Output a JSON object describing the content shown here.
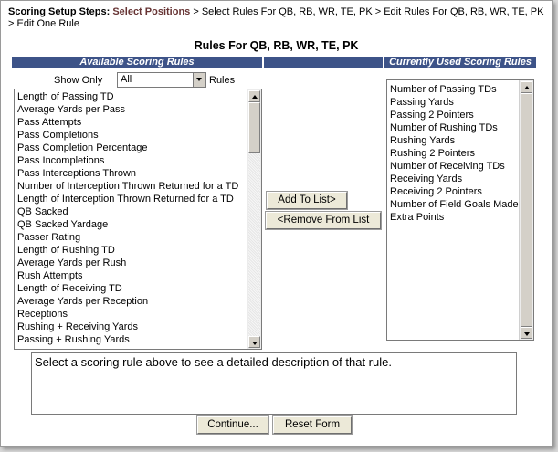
{
  "breadcrumb": {
    "label": "Scoring Setup Steps:",
    "current": "Select Positions",
    "rest": " > Select Rules For QB, RB, WR, TE, PK > Edit Rules For QB, RB, WR, TE, PK > Edit One Rule"
  },
  "page_title": "Rules For QB, RB, WR, TE, PK",
  "available": {
    "header": "Available Scoring Rules",
    "show_only_label": "Show Only",
    "filter_value": "All",
    "rules_suffix": "Rules",
    "items": [
      "Length of Passing TD",
      "Average Yards per Pass",
      "Pass Attempts",
      "Pass Completions",
      "Pass Completion Percentage",
      "Pass Incompletions",
      "Pass Interceptions Thrown",
      "Number of Interception Thrown Returned for a TD",
      "Length of Interception Thrown Returned for a TD",
      "QB Sacked",
      "QB Sacked Yardage",
      "Passer Rating",
      "Length of Rushing TD",
      "Average Yards per Rush",
      "Rush Attempts",
      "Length of Receiving TD",
      "Average Yards per Reception",
      "Receptions",
      "Rushing + Receiving Yards",
      "Passing + Rushing Yards"
    ]
  },
  "used": {
    "header": "Currently Used Scoring Rules",
    "items": [
      "Number of Passing TDs",
      "Passing Yards",
      "Passing 2 Pointers",
      "Number of Rushing TDs",
      "Rushing Yards",
      "Rushing 2 Pointers",
      "Number of Receiving TDs",
      "Receiving Yards",
      "Receiving 2 Pointers",
      "Number of Field Goals Made",
      "Extra Points"
    ]
  },
  "buttons": {
    "add": "Add To List>",
    "remove": "<Remove From List",
    "continue": "Continue...",
    "reset": "Reset Form"
  },
  "description": "Select a scoring rule above to see a detailed description of that rule.",
  "colors": {
    "header_bg": "#3d5388",
    "current_step": "#663333"
  }
}
